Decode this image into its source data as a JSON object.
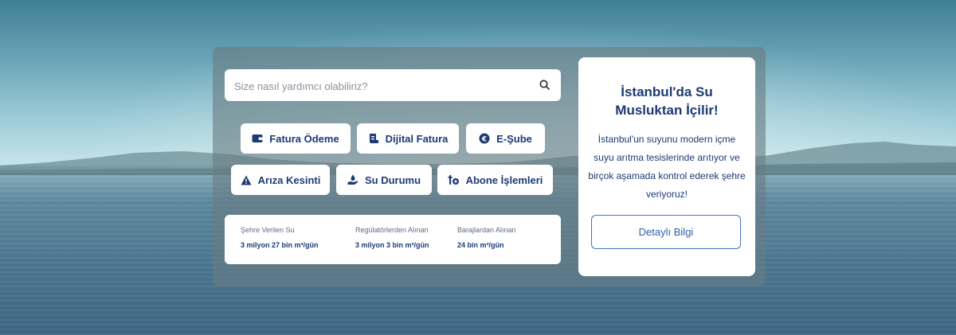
{
  "search": {
    "placeholder": "Size nasıl yardımcı olabiliriz?"
  },
  "actions_row1": [
    {
      "label": "Fatura Ödeme",
      "icon": "wallet-icon"
    },
    {
      "label": "Dijital Fatura",
      "icon": "digital-invoice-icon"
    },
    {
      "label": "E-Şube",
      "icon": "euro-coin-icon"
    }
  ],
  "actions_row2": [
    {
      "label": "Arıza Kesinti",
      "icon": "warning-icon"
    },
    {
      "label": "Su Durumu",
      "icon": "water-hand-icon"
    },
    {
      "label": "Abone İşlemleri",
      "icon": "subscriber-icon"
    }
  ],
  "stats": [
    {
      "label": "Şehre Verilen Su",
      "value": "3 milyon 27 bin m³/gün"
    },
    {
      "label": "Regülatörlerden Alınan",
      "value": "3 milyon 3 bin m³/gün"
    },
    {
      "label": "Barajlardan Alınan",
      "value": "24 bin m³/gün"
    }
  ],
  "info": {
    "title": "İstanbul'da Su Musluktan İçilir!",
    "body": "İstanbul'un suyunu modern içme suyu arıtma tesislerinde arıtıyor ve birçok aşamada kontrol ederek şehre veriyoruz!",
    "button_label": "Detaylı Bilgi"
  },
  "colors": {
    "accent": "#1d3a73",
    "button_border": "#3f74c2",
    "panel": "#697d82"
  }
}
